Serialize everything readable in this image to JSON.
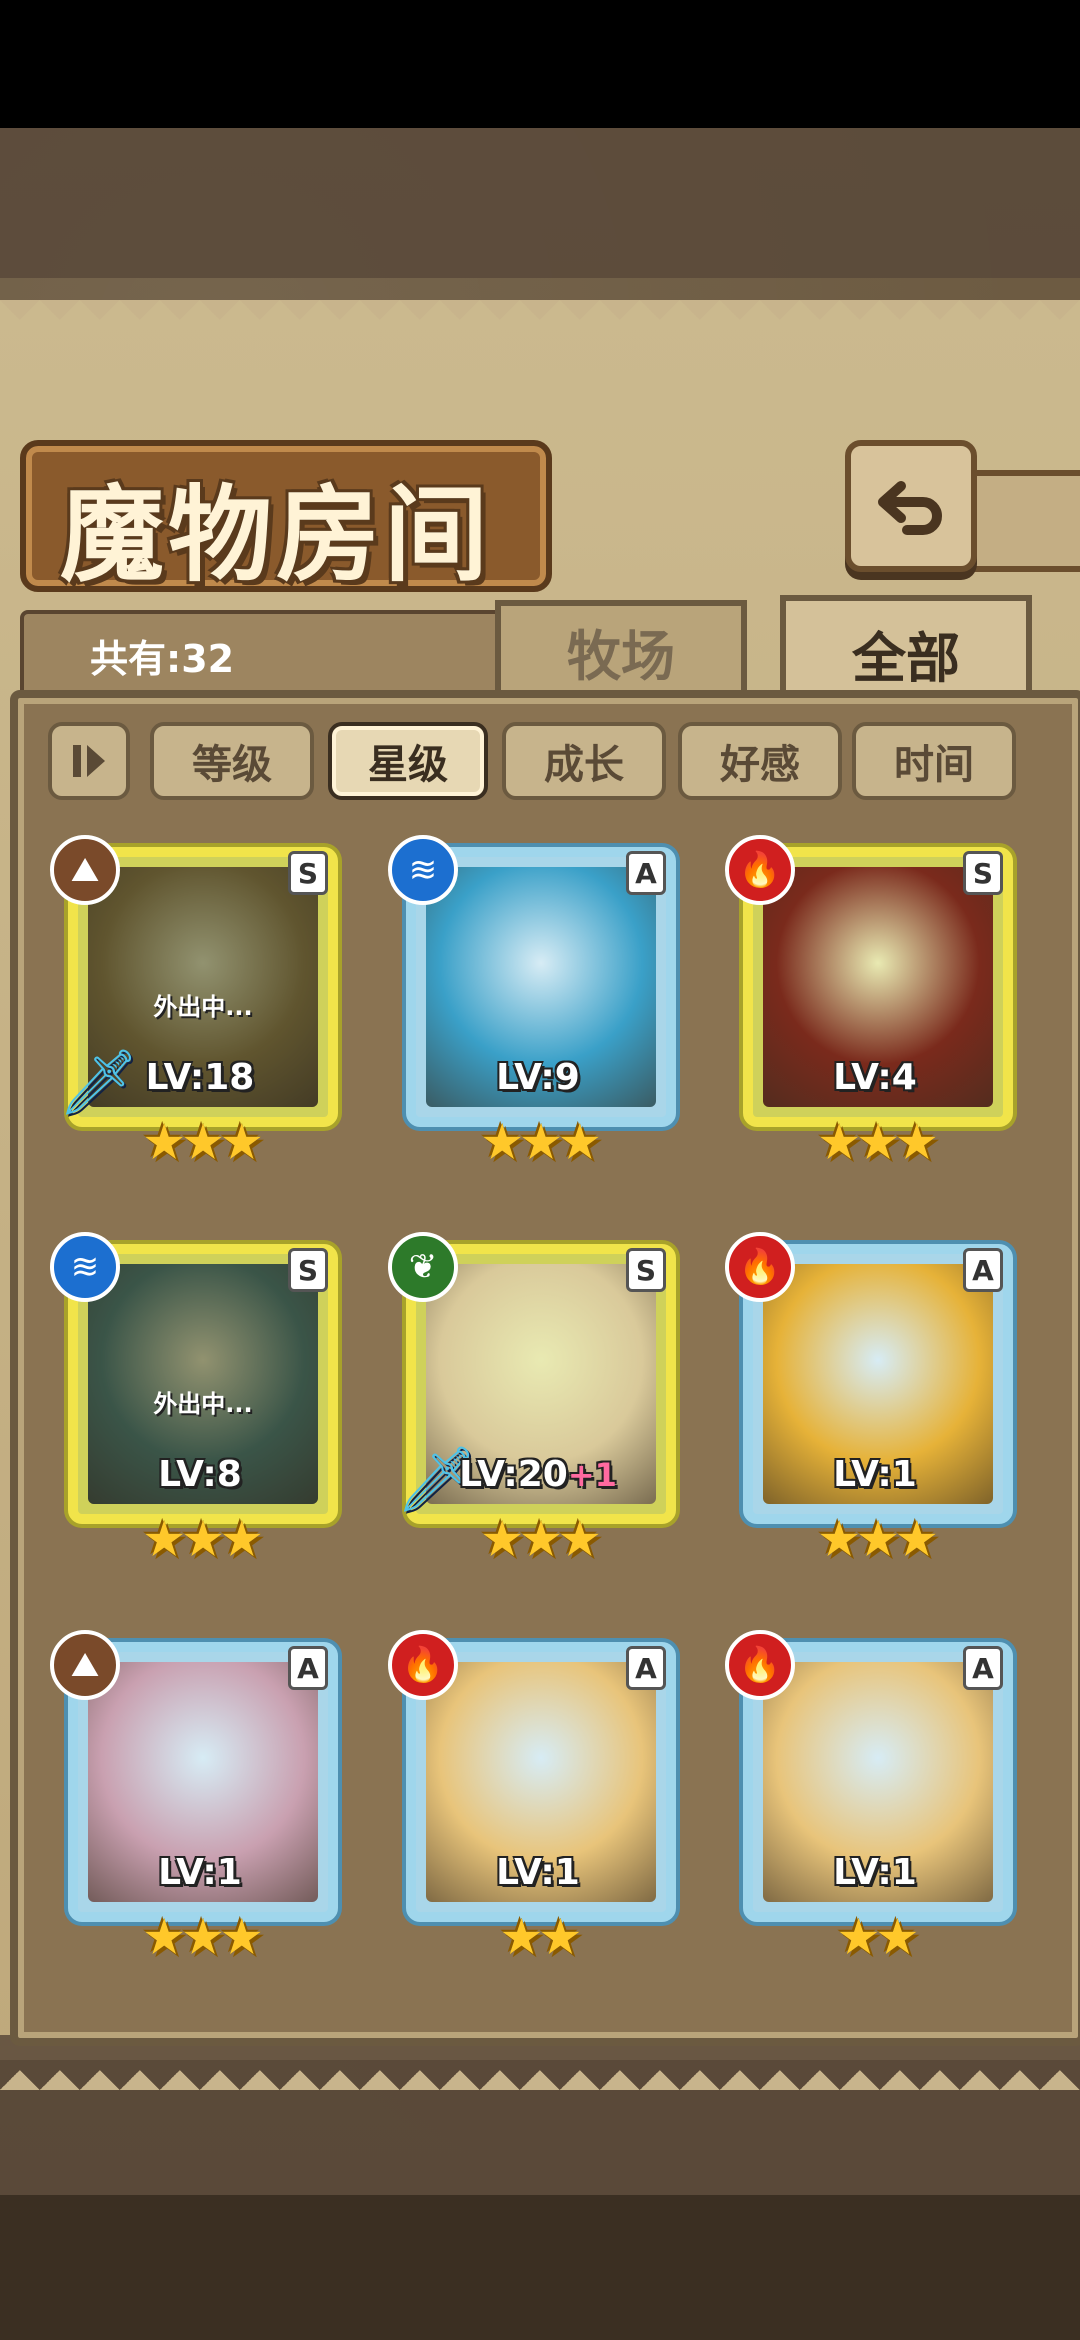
{
  "title": "魔物房间",
  "count_label": "共有:32",
  "tabs": {
    "farm": "牧场",
    "all": "全部"
  },
  "filters": [
    {
      "label": "等级",
      "active": false
    },
    {
      "label": "星级",
      "active": true
    },
    {
      "label": "成长",
      "active": false
    },
    {
      "label": "好感",
      "active": false
    },
    {
      "label": "时间",
      "active": false
    }
  ],
  "away_text": "外出中...",
  "monsters": [
    {
      "rank": "S",
      "element": "earth",
      "level": "LV:18",
      "bonus": "",
      "stars": "★★★",
      "away": true,
      "weapon": true,
      "portrait_color": "#8e7a3c"
    },
    {
      "rank": "A",
      "element": "water",
      "level": "LV:9",
      "bonus": "",
      "stars": "★★★",
      "away": false,
      "weapon": false,
      "portrait_color": "#3aa0c8"
    },
    {
      "rank": "S",
      "element": "fire",
      "level": "LV:4",
      "bonus": "",
      "stars": "★★★",
      "away": false,
      "weapon": false,
      "portrait_color": "#7a2a1c"
    },
    {
      "rank": "S",
      "element": "water",
      "level": "LV:8",
      "bonus": "",
      "stars": "★★★",
      "away": true,
      "weapon": false,
      "portrait_color": "#4a7a6a"
    },
    {
      "rank": "S",
      "element": "wood",
      "level": "LV:20",
      "bonus": "+1",
      "stars": "★★★",
      "away": false,
      "weapon": true,
      "portrait_color": "#d9c99a"
    },
    {
      "rank": "A",
      "element": "fire",
      "level": "LV:1",
      "bonus": "",
      "stars": "★★★",
      "away": false,
      "weapon": false,
      "portrait_color": "#e6b238"
    },
    {
      "rank": "A",
      "element": "earth",
      "level": "LV:1",
      "bonus": "",
      "stars": "★★★",
      "away": false,
      "weapon": false,
      "portrait_color": "#c9a0b0"
    },
    {
      "rank": "A",
      "element": "fire",
      "level": "LV:1",
      "bonus": "",
      "stars": "★★",
      "away": false,
      "weapon": false,
      "portrait_color": "#e8c47a"
    },
    {
      "rank": "A",
      "element": "fire",
      "level": "LV:1",
      "bonus": "",
      "stars": "★★",
      "away": false,
      "weapon": false,
      "portrait_color": "#e8c47a"
    }
  ]
}
